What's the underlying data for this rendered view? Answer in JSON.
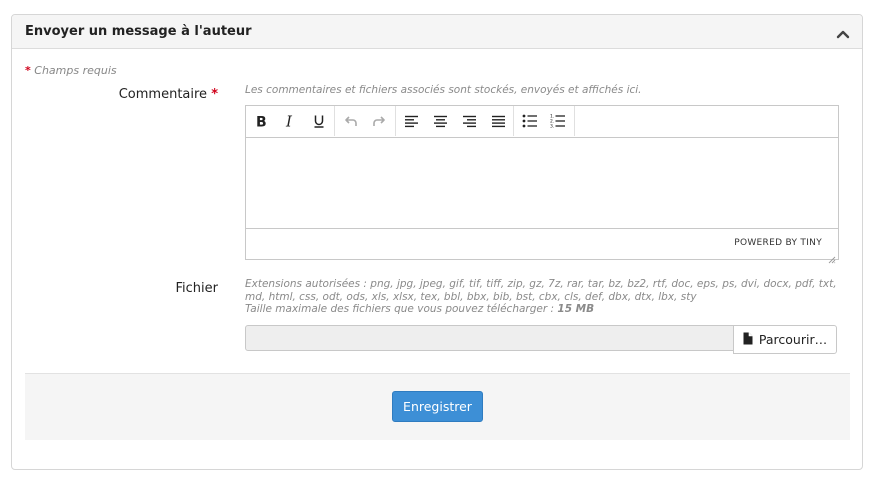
{
  "panel": {
    "title": "Envoyer un message à l'auteur"
  },
  "form": {
    "required_star": "*",
    "required_note": "Champs requis",
    "comment": {
      "label": "Commentaire",
      "help": "Les commentaires et fichiers associés sont stockés, envoyés et affichés ici."
    },
    "editor": {
      "toolbar_icons": [
        "bold-icon",
        "italic-icon",
        "underline-icon",
        "undo-icon",
        "redo-icon",
        "align-left-icon",
        "align-center-icon",
        "align-right-icon",
        "align-justify-icon",
        "bullet-list-icon",
        "numbered-list-icon"
      ],
      "powered_by": "POWERED BY TINY"
    },
    "file": {
      "label": "Fichier",
      "extensions_line1": "Extensions autorisées : png, jpg, jpeg, gif, tif, tiff, zip, gz, 7z, rar, tar, bz, bz2, rtf, doc, eps, ps, dvi, docx, pdf, txt,",
      "extensions_line2": "md, html, css, odt, ods, xls, xlsx, tex, bbl, bbx, bib, bst, cbx, cls, def, dbx, dtx, lbx, sty",
      "max_size_label": "Taille maximale des fichiers que vous pouvez télécharger : ",
      "max_size_value": "15 MB",
      "browse_label": "Parcourir…"
    },
    "submit_label": "Enregistrer"
  },
  "colors": {
    "primary": "#3d8fd6",
    "required": "#d0021b"
  }
}
